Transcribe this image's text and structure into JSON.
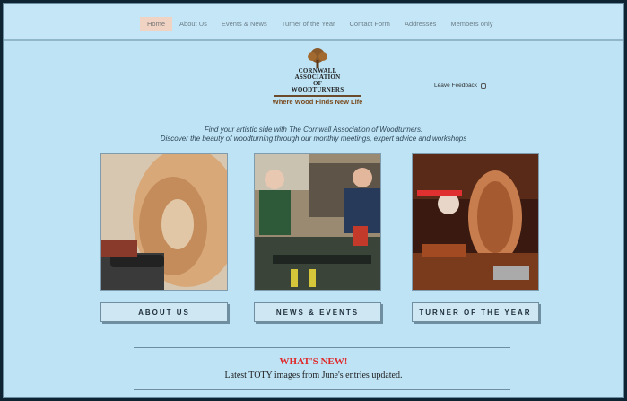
{
  "nav": {
    "items": [
      "Home",
      "About Us",
      "Events & News",
      "Turner of the Year",
      "Contact Form",
      "Addresses",
      "Members only"
    ],
    "active_index": 0
  },
  "logo": {
    "line1": "CORNWALL",
    "line2": "ASSOCIATION",
    "line3": "OF",
    "line4": "WOODTURNERS",
    "tagline": "Where Wood Finds New Life"
  },
  "feedback": {
    "label": "Leave Feedback"
  },
  "intro": {
    "line1": "Find your artistic side with The Cornwall Association of Woodturners.",
    "line2": "Discover the beauty of woodturning through our monthly meetings, expert advice and workshops"
  },
  "cards": [
    {
      "label": "ABOUT US"
    },
    {
      "label": "NEWS & EVENTS"
    },
    {
      "label": "TURNER OF THE YEAR"
    }
  ],
  "news": {
    "heading": "WHAT'S NEW!",
    "update": "Latest TOTY images from June's entries updated."
  },
  "colors": {
    "page_bg": "#bde3f5",
    "active_tab": "#f1d3c3",
    "heading_red": "#e02a2a",
    "tagline_brown": "#7a4a1e"
  }
}
